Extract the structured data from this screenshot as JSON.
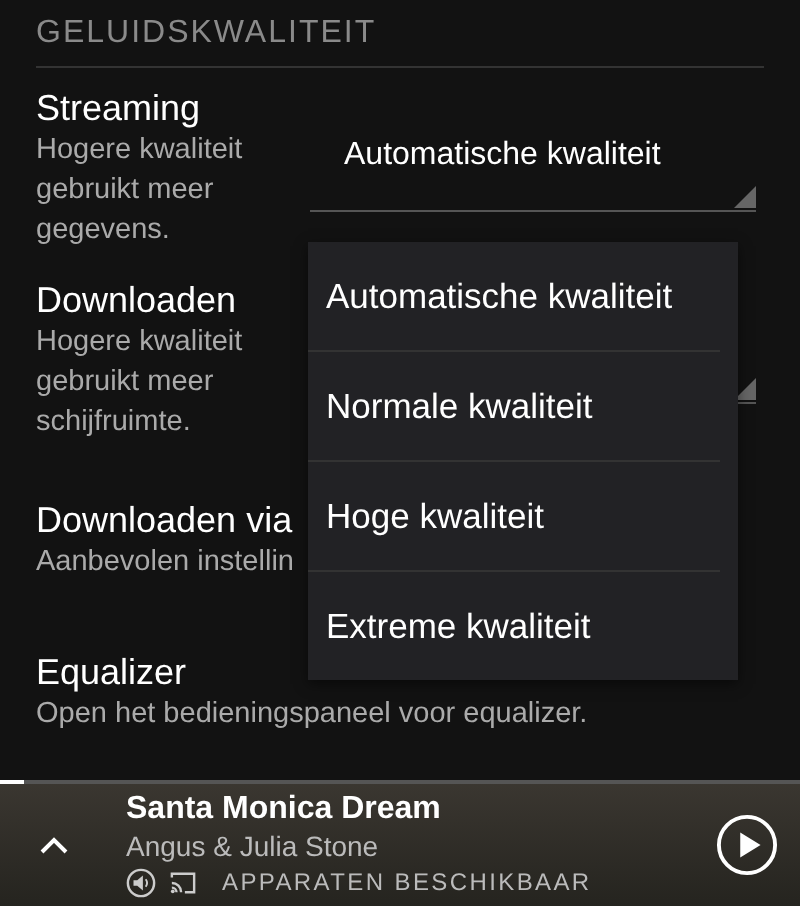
{
  "section_header": "GELUIDSKWALITEIT",
  "settings": [
    {
      "kind": "dropdown",
      "title": "Streaming",
      "description": "Hogere kwaliteit gebruikt meer gegevens.",
      "value": "Automatische kwaliteit"
    },
    {
      "kind": "dropdown",
      "title": "Downloaden",
      "description": "Hogere kwaliteit gebruikt meer schijfruimte."
    },
    {
      "kind": "toggle",
      "title": "Downloaden via",
      "description": "Aanbevolen instellin"
    },
    {
      "kind": "link",
      "title": "Equalizer",
      "description": "Open het bedieningspaneel voor equalizer."
    }
  ],
  "dropdown_menu": {
    "options": [
      "Automatische kwaliteit",
      "Normale kwaliteit",
      "Hoge kwaliteit",
      "Extreme kwaliteit"
    ]
  },
  "player": {
    "title": "Santa Monica Dream",
    "artist": "Angus & Julia Stone",
    "devices": "APPARATEN BESCHIKBAAR",
    "level": 0.03
  }
}
